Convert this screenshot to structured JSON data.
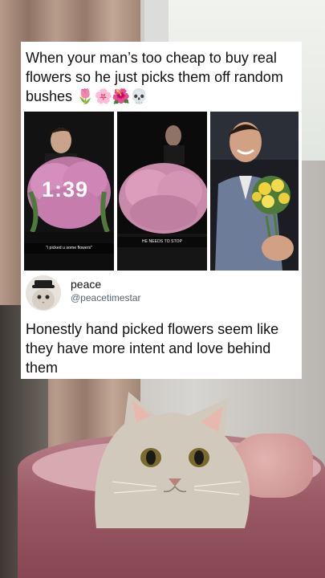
{
  "post": {
    "caption": "When your man’s too cheap to buy real flowers so he just picks them off random bushes 🌷🌸🌺💀"
  },
  "photos": [
    {
      "name": "photo-guy-with-pink-bush",
      "overlay_time": "1:39",
      "snap_caption": "\"i picked u some flowers\""
    },
    {
      "name": "photo-night-pink-bush",
      "snap_caption": "HE NEEDS TO STOP"
    },
    {
      "name": "photo-guy-with-yellow-flowers"
    }
  ],
  "tweet": {
    "display_name": "peace",
    "handle": "@peacetimestar",
    "text": "Honestly hand picked flowers seem like they have more intent and love behind them"
  },
  "icons": {
    "avatar": "cat-avatar-icon"
  },
  "colors": {
    "card_bg": "#ffffff",
    "text": "#111111",
    "handle": "#536471",
    "pink_flowers": "#d98fb3",
    "yellow_flowers": "#f0d23c",
    "basket": "#9b5a66"
  }
}
